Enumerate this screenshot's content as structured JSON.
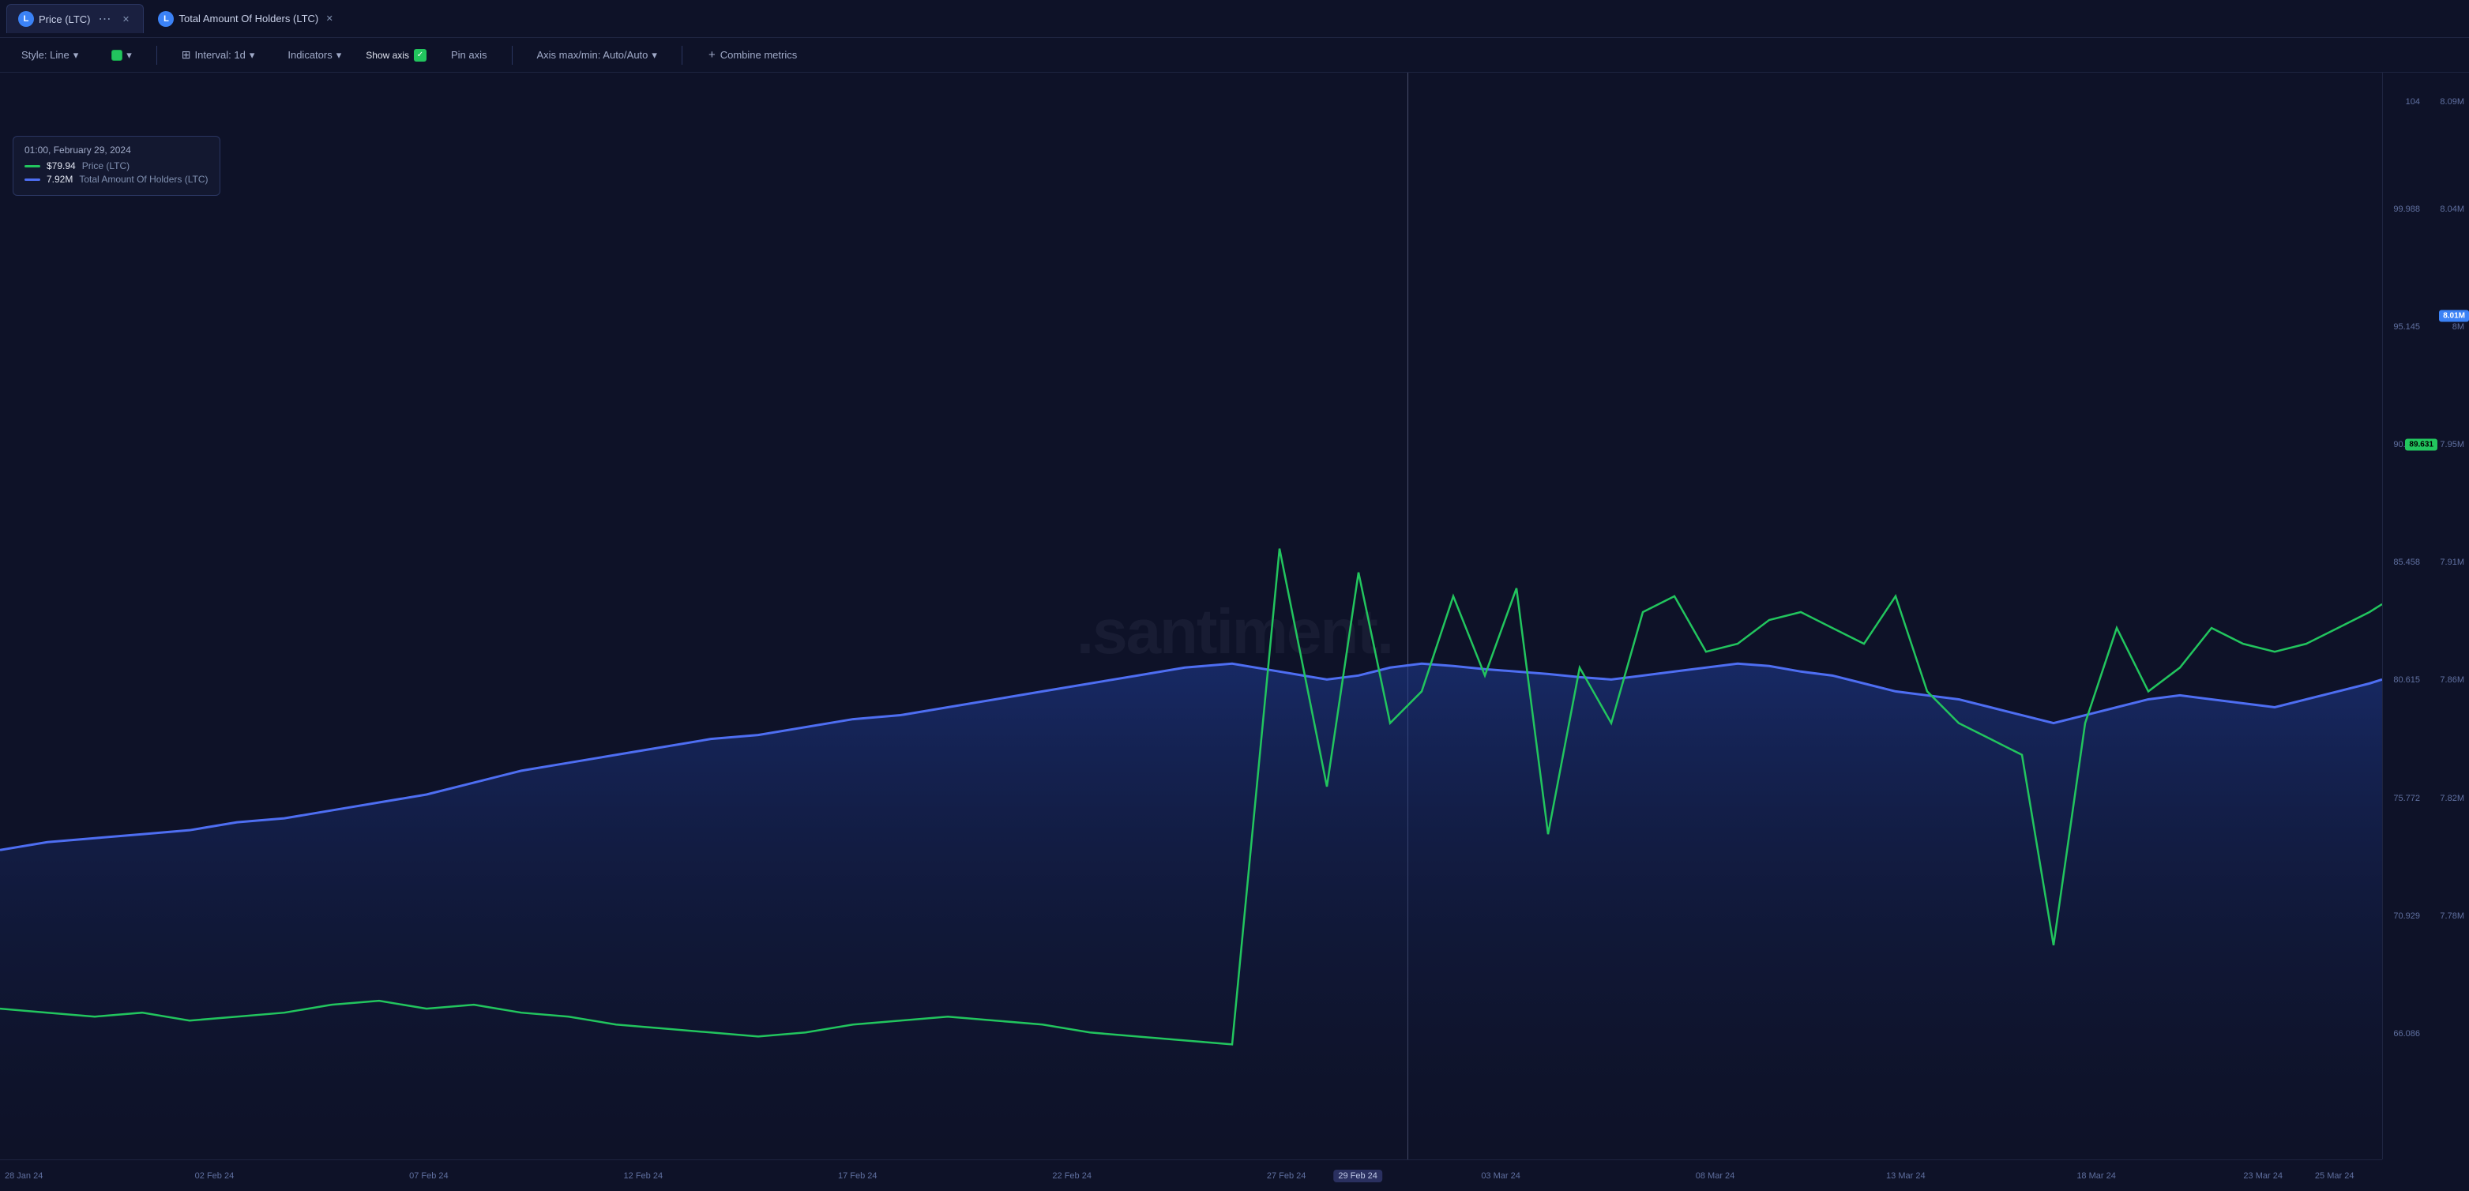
{
  "tabs": [
    {
      "id": "price-ltc",
      "icon": "L",
      "icon_color": "#3b82f6",
      "label": "Price (LTC)",
      "active": true,
      "has_menu": true,
      "has_close": true
    },
    {
      "id": "holders-ltc",
      "icon": "L",
      "icon_color": "#3b82f6",
      "label": "Total Amount Of Holders (LTC)",
      "active": false,
      "has_menu": false,
      "has_close": true
    }
  ],
  "toolbar": {
    "style_label": "Style: Line",
    "color_label": "",
    "interval_label": "Interval: 1d",
    "indicators_label": "Indicators",
    "show_axis_label": "Show axis",
    "pin_axis_label": "Pin axis",
    "axis_maxmin_label": "Axis max/min: Auto/Auto",
    "combine_label": "Combine metrics"
  },
  "tooltip": {
    "date": "01:00, February 29, 2024",
    "price_value": "$79.94",
    "price_label": "Price (LTC)",
    "holders_value": "7.92M",
    "holders_label": "Total Amount Of Holders (LTC)"
  },
  "watermark": ".santiment.",
  "right_axis": {
    "left_labels": [
      {
        "value": "104",
        "pct": 2
      },
      {
        "value": "99.988",
        "pct": 12
      },
      {
        "value": "95.145",
        "pct": 23
      },
      {
        "value": "90.302",
        "pct": 34
      },
      {
        "value": "85.458",
        "pct": 45
      },
      {
        "value": "80.615",
        "pct": 56
      },
      {
        "value": "75.772",
        "pct": 67
      },
      {
        "value": "70.929",
        "pct": 78
      },
      {
        "value": "66.086",
        "pct": 89
      }
    ],
    "right_labels": [
      {
        "value": "8.09M",
        "pct": 2
      },
      {
        "value": "8.04M",
        "pct": 12
      },
      {
        "value": "8M",
        "pct": 23
      },
      {
        "value": "7.95M",
        "pct": 34
      },
      {
        "value": "7.91M",
        "pct": 45
      },
      {
        "value": "7.86M",
        "pct": 56
      },
      {
        "value": "7.82M",
        "pct": 67
      },
      {
        "value": "7.78M",
        "pct": 78
      }
    ],
    "badge_green": {
      "value": "89.631",
      "pct": 34
    },
    "badge_blue": {
      "value": "8.01M",
      "pct": 22
    }
  },
  "x_axis": [
    {
      "label": "28 Jan 24",
      "pct": 1
    },
    {
      "label": "02 Feb 24",
      "pct": 9
    },
    {
      "label": "07 Feb 24",
      "pct": 18
    },
    {
      "label": "12 Feb 24",
      "pct": 27
    },
    {
      "label": "17 Feb 24",
      "pct": 36
    },
    {
      "label": "22 Feb 24",
      "pct": 45
    },
    {
      "label": "27 Feb 24",
      "pct": 54
    },
    {
      "label": "29 Feb 24",
      "pct": 57,
      "highlighted": true
    },
    {
      "label": "03 Mar 24",
      "pct": 63
    },
    {
      "label": "08 Mar 24",
      "pct": 72
    },
    {
      "label": "13 Mar 24",
      "pct": 80
    },
    {
      "label": "18 Mar 24",
      "pct": 88
    },
    {
      "label": "23 Mar 24",
      "pct": 95
    },
    {
      "label": "25 Mar 24",
      "pct": 98
    }
  ],
  "vertical_line_pct": 57
}
